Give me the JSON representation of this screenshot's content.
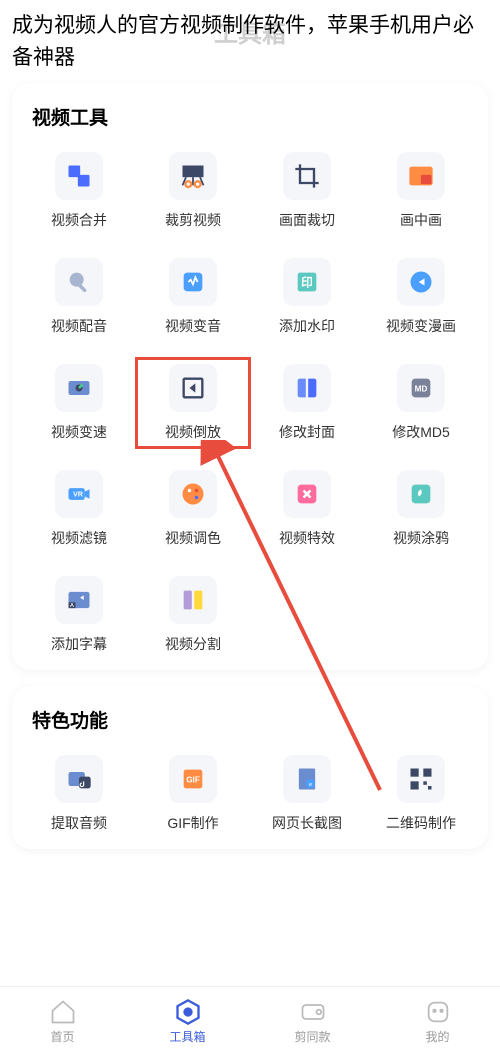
{
  "header": {
    "text": "成为视频人的官方视频制作软件，苹果手机用户必备神器",
    "faint_title": "工具箱"
  },
  "sections": [
    {
      "title": "视频工具",
      "tools": [
        {
          "label": "视频合并",
          "icon": "merge"
        },
        {
          "label": "裁剪视频",
          "icon": "trim"
        },
        {
          "label": "画面裁切",
          "icon": "crop"
        },
        {
          "label": "画中画",
          "icon": "pip"
        },
        {
          "label": "视频配音",
          "icon": "mic"
        },
        {
          "label": "视频变音",
          "icon": "voice"
        },
        {
          "label": "添加水印",
          "icon": "watermark"
        },
        {
          "label": "视频变漫画",
          "icon": "comic"
        },
        {
          "label": "视频变速",
          "icon": "speed"
        },
        {
          "label": "视频倒放",
          "icon": "reverse",
          "highlighted": true
        },
        {
          "label": "修改封面",
          "icon": "cover"
        },
        {
          "label": "修改MD5",
          "icon": "md5"
        },
        {
          "label": "视频滤镜",
          "icon": "filter"
        },
        {
          "label": "视频调色",
          "icon": "color"
        },
        {
          "label": "视频特效",
          "icon": "effect"
        },
        {
          "label": "视频涂鸦",
          "icon": "doodle"
        },
        {
          "label": "添加字幕",
          "icon": "subtitle"
        },
        {
          "label": "视频分割",
          "icon": "split"
        }
      ]
    },
    {
      "title": "特色功能",
      "tools": [
        {
          "label": "提取音频",
          "icon": "extract-audio"
        },
        {
          "label": "GIF制作",
          "icon": "gif"
        },
        {
          "label": "网页长截图",
          "icon": "screenshot"
        },
        {
          "label": "二维码制作",
          "icon": "qrcode"
        }
      ]
    }
  ],
  "nav": [
    {
      "label": "首页",
      "icon": "home"
    },
    {
      "label": "工具箱",
      "icon": "toolbox",
      "active": true
    },
    {
      "label": "剪同款",
      "icon": "template"
    },
    {
      "label": "我的",
      "icon": "profile"
    }
  ]
}
